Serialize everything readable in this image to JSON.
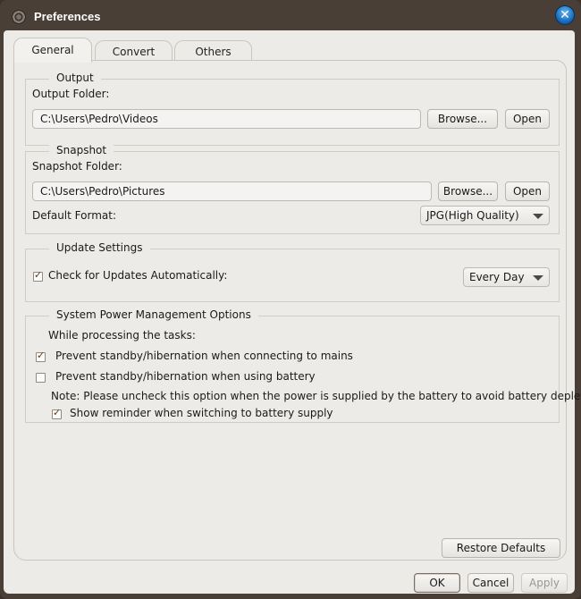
{
  "window": {
    "title": "Preferences",
    "app_icon": "film-reel-icon",
    "close_icon": "close-icon",
    "close_glyph": "✕"
  },
  "tabs": [
    {
      "label": "General",
      "active": true
    },
    {
      "label": "Convert",
      "active": false
    },
    {
      "label": "Others",
      "active": false
    }
  ],
  "output": {
    "title": "Output",
    "folder_label": "Output Folder:",
    "folder_value": "C:\\Users\\Pedro\\Videos",
    "browse_label": "Browse...",
    "open_label": "Open"
  },
  "snapshot": {
    "title": "Snapshot",
    "folder_label": "Snapshot Folder:",
    "folder_value": "C:\\Users\\Pedro\\Pictures",
    "browse_label": "Browse...",
    "open_label": "Open",
    "format_label": "Default Format:",
    "format_value": "JPG(High Quality)"
  },
  "update": {
    "title": "Update Settings",
    "check_label": "Check for Updates Automatically:",
    "check_checked": true,
    "frequency_value": "Every Day"
  },
  "power": {
    "title": "System Power Management Options",
    "intro": "While processing the tasks:",
    "options": [
      {
        "label": "Prevent standby/hibernation when connecting to mains",
        "checked": true
      },
      {
        "label": "Prevent standby/hibernation when using battery",
        "checked": false
      }
    ],
    "note": "Note: Please uncheck this option when the power is supplied by the battery to avoid battery depletion.",
    "reminder_label": "Show reminder when switching to battery supply",
    "reminder_checked": true
  },
  "check_glyph": "✓",
  "footer": {
    "restore_label": "Restore Defaults",
    "ok_label": "OK",
    "cancel_label": "Cancel",
    "apply_label": "Apply"
  }
}
